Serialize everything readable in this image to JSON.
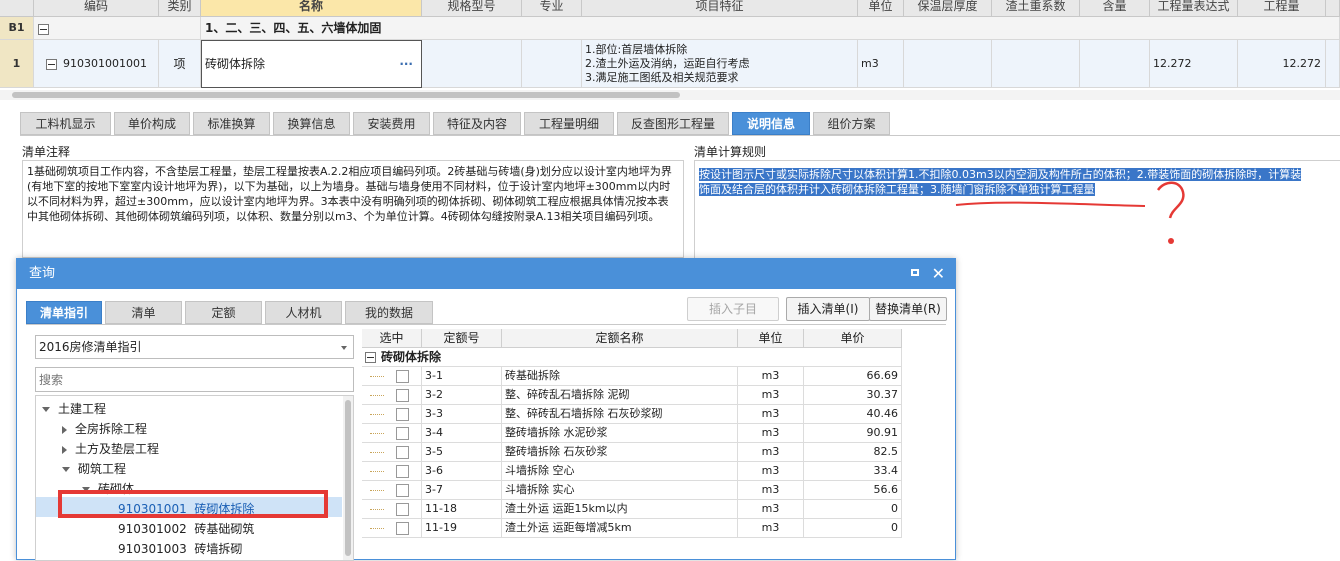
{
  "grid": {
    "headers": [
      "编码",
      "类别",
      "名称",
      "规格型号",
      "专业",
      "项目特征",
      "单位",
      "保温层厚度",
      "渣土重系数",
      "含量",
      "工程量表达式",
      "工程量"
    ],
    "section_row": {
      "num": "B1",
      "name": "1、二、三、四、五、六墙体加固"
    },
    "row1": {
      "num": "1",
      "code": "910301001001",
      "type": "项",
      "name": "砖砌体拆除",
      "ellipsis": "···",
      "feature_lines": [
        "1.部位:首层墙体拆除",
        "2.渣土外运及消纳，运距自行考虑",
        "3.满足施工图纸及相关规范要求"
      ],
      "unit": "m3",
      "expression": "12.272",
      "quantity": "12.272"
    }
  },
  "tabs": [
    "工料机显示",
    "单价构成",
    "标准换算",
    "换算信息",
    "安装费用",
    "特征及内容",
    "工程量明细",
    "反查图形工程量",
    "说明信息",
    "组价方案"
  ],
  "active_tab": "说明信息",
  "notes": {
    "left_label": "清单注释",
    "left_text": "1基础砌筑项目工作内容，不含垫层工程量，垫层工程量按表A.2.2相应项目编码列项。2砖基础与砖墙(身)划分应以设计室内地坪为界(有地下室的按地下室室内设计地坪为界)，以下为基础，以上为墙身。基础与墙身使用不同材料，位于设计室内地坪±300mm以内时以不同材料为界，超过±300mm，应以设计室内地坪为界。3本表中没有明确列项的砌体拆砌、砌体砌筑工程应根据具体情况按本表中其他砌体拆砌、其他砌体砌筑编码列项，以体积、数量分别以m3、个为单位计算。4砖砌体勾缝按附录A.13相关项目编码列项。",
    "right_label": "清单计算规则",
    "right_text_line1": "按设计图示尺寸或实际拆除尺寸以体积计算1.不扣除0.03m3以内空洞及构件所占的体积；2.带装饰面的砌体拆除时，计算装",
    "right_text_line2": "饰面及结合层的体积并计入砖砌体拆除工程量；3.随墙门窗拆除不单独计算工程量",
    "annotation_color": "#e53935"
  },
  "dialog": {
    "title": "查询",
    "tabs": [
      "清单指引",
      "清单",
      "定额",
      "人材机",
      "我的数据"
    ],
    "active_tab": "清单指引",
    "buttons": {
      "insert_child": "插入子目",
      "insert_list": "插入清单(I)",
      "replace_list": "替换清单(R)"
    },
    "select_value": "2016房修清单指引",
    "search_placeholder": "搜索",
    "tree": [
      {
        "label": "土建工程",
        "expanded": true
      },
      {
        "label": "全房拆除工程"
      },
      {
        "label": "土方及垫层工程"
      },
      {
        "label": "砌筑工程",
        "expanded": true
      },
      {
        "label": "砖砌体"
      },
      {
        "code": "910301001",
        "label": "砖砌体拆除",
        "selected": true
      },
      {
        "code": "910301002",
        "label": "砖基础砌筑"
      },
      {
        "code": "910301003",
        "label": "砖墙拆砌"
      }
    ],
    "table_headers": [
      "选中",
      "定额号",
      "定额名称",
      "单位",
      "单价"
    ],
    "group_label": "砖砌体拆除",
    "rows": [
      {
        "code": "3-1",
        "name": "砖基础拆除",
        "unit": "m3",
        "price": "66.69"
      },
      {
        "code": "3-2",
        "name": "整、碎砖乱石墙拆除 泥砌",
        "unit": "m3",
        "price": "30.37"
      },
      {
        "code": "3-3",
        "name": "整、碎砖乱石墙拆除 石灰砂浆砌",
        "unit": "m3",
        "price": "40.46"
      },
      {
        "code": "3-4",
        "name": "整砖墙拆除 水泥砂浆",
        "unit": "m3",
        "price": "90.91"
      },
      {
        "code": "3-5",
        "name": "整砖墙拆除 石灰砂浆",
        "unit": "m3",
        "price": "82.5"
      },
      {
        "code": "3-6",
        "name": "斗墙拆除 空心",
        "unit": "m3",
        "price": "33.4"
      },
      {
        "code": "3-7",
        "name": "斗墙拆除 实心",
        "unit": "m3",
        "price": "56.6"
      },
      {
        "code": "11-18",
        "name": "渣土外运 运距15km以内",
        "unit": "m3",
        "price": "0"
      },
      {
        "code": "11-19",
        "name": "渣土外运 运距每增减5km",
        "unit": "m3",
        "price": "0"
      }
    ]
  },
  "colors": {
    "accent": "#4a90d9",
    "highlight": "#3a76c8",
    "marker": "#e53935"
  }
}
